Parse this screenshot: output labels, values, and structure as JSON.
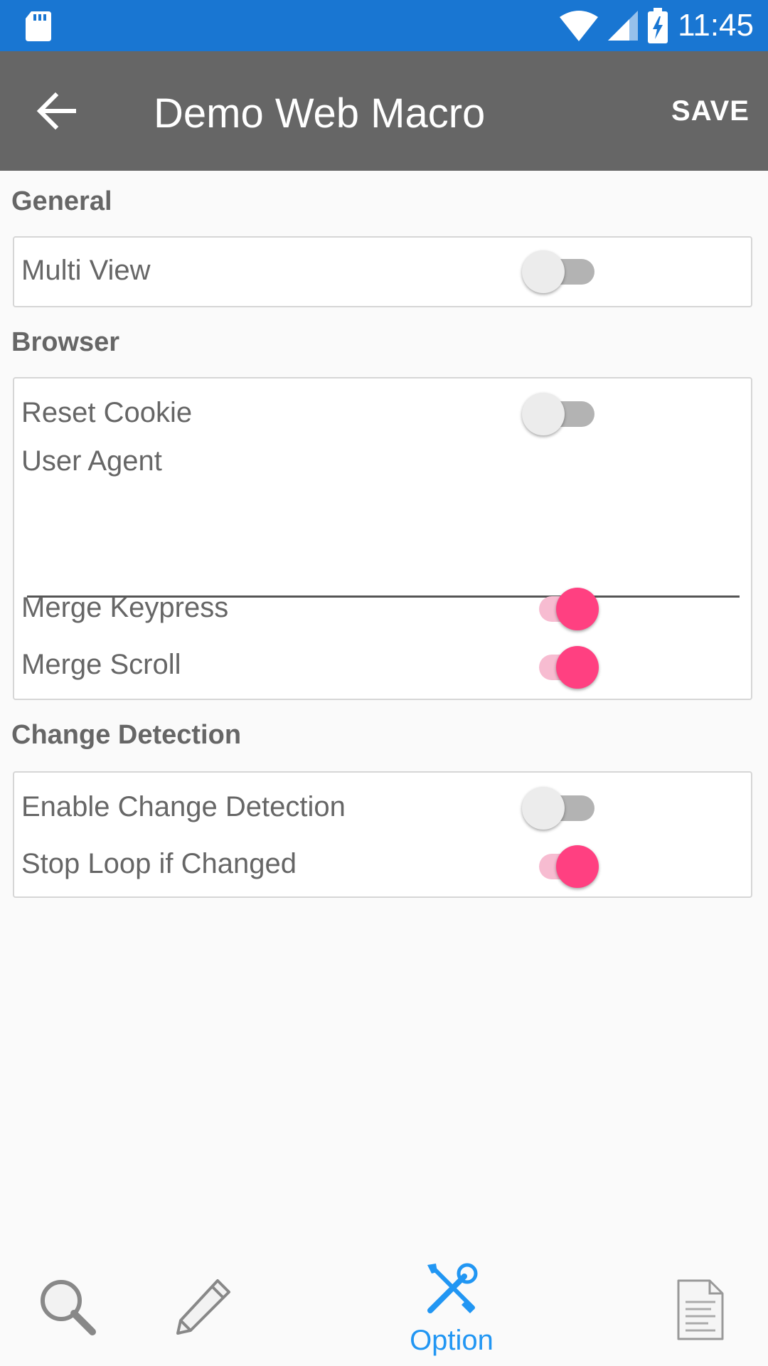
{
  "status_bar": {
    "time": "11:45",
    "color": "#1976d2"
  },
  "app_bar": {
    "title": "Demo Web Macro",
    "save_label": "SAVE",
    "back_icon": "arrow-left-icon",
    "color": "#666666"
  },
  "sections": {
    "general": {
      "title": "General",
      "multi_view": {
        "label": "Multi View",
        "on": false
      }
    },
    "browser": {
      "title": "Browser",
      "reset_cookie": {
        "label": "Reset Cookie",
        "on": false
      },
      "user_agent": {
        "label": "User Agent",
        "value": "",
        "placeholder": ""
      },
      "merge_keypress": {
        "label": "Merge Keypress",
        "on": true
      },
      "merge_scroll": {
        "label": "Merge Scroll",
        "on": true
      }
    },
    "change_detection": {
      "title": "Change Detection",
      "enable_change_detection": {
        "label": "Enable Change Detection",
        "on": false
      },
      "stop_loop_if_changed": {
        "label": "Stop Loop if Changed",
        "on": true
      }
    }
  },
  "bottom_nav": {
    "items": [
      {
        "icon": "search-icon",
        "label": ""
      },
      {
        "icon": "pencil-icon",
        "label": ""
      },
      {
        "icon": "tools-icon",
        "label": "Option",
        "active": true
      },
      {
        "icon": "document-icon",
        "label": ""
      }
    ],
    "active_color": "#2196f3"
  },
  "accent_color": "#ff4081"
}
